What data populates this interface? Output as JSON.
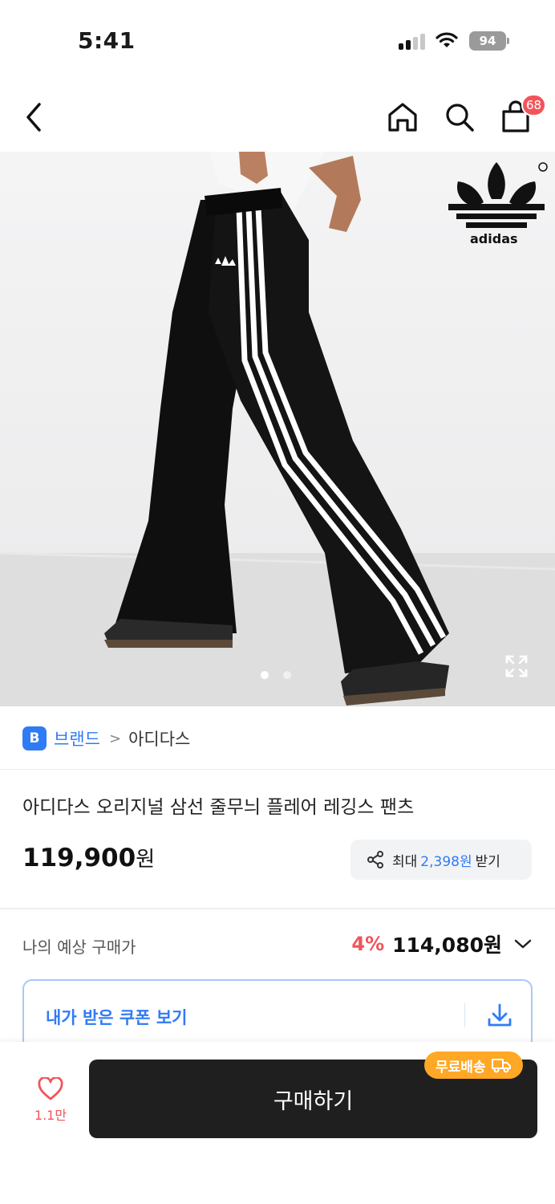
{
  "status_bar": {
    "time": "5:41",
    "battery": "94"
  },
  "header": {
    "cart_count": "68"
  },
  "hero": {
    "logo_text": "adidas",
    "pages": 2,
    "active_page": 1
  },
  "brand": {
    "badge": "B",
    "link_label": "브랜드",
    "separator": ">",
    "name": "아디다스"
  },
  "product": {
    "title": "아디다스 오리지널 삼선 줄무늬 플레어 레깅스 팬츠",
    "price": "119,900",
    "price_unit": "원"
  },
  "reward": {
    "prefix": "최대",
    "amount": "2,398원",
    "suffix": "받기"
  },
  "expected": {
    "label": "나의 예상 구매가",
    "discount": "4%",
    "price": "114,080원"
  },
  "coupon": {
    "label": "내가 받은 쿠폰 보기"
  },
  "bottom": {
    "like_count": "1.1만",
    "buy_label": "구매하기",
    "free_shipping": "무료배송"
  },
  "colors": {
    "accent_blue": "#2f7bf5",
    "accent_red": "#f2545b",
    "free_ship_orange": "#ffa825",
    "buy_button": "#1f1f1f"
  }
}
